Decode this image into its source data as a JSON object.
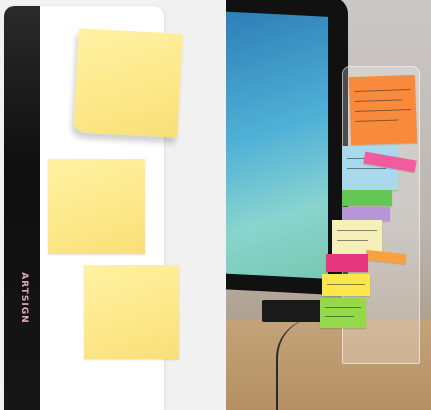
{
  "product_panel": {
    "brand_logo": "ARTSIGN",
    "colors": {
      "strip": "#111111",
      "board": "#ffffff",
      "sticky_note": "#fde98a",
      "logo": "#e2a9bd"
    },
    "sticky_notes": [
      "sticky-note-1",
      "sticky-note-2",
      "sticky-note-3"
    ]
  },
  "photo_panel": {
    "colors": {
      "screen": "#4fb0d6",
      "desk": "#b48f63",
      "wall": "#c4bfbb"
    },
    "memo_notes": [
      {
        "name": "orange-note",
        "color": "#f98a3b"
      },
      {
        "name": "light-blue-note",
        "color": "#a9d9ec"
      },
      {
        "name": "pink-tab",
        "color": "#f25c9c"
      },
      {
        "name": "green-note",
        "color": "#63c657"
      },
      {
        "name": "purple-note",
        "color": "#b695d8"
      },
      {
        "name": "light-yellow-note",
        "color": "#f5f0b8"
      },
      {
        "name": "orange-tab",
        "color": "#f7a23f"
      },
      {
        "name": "magenta-note",
        "color": "#e4377d"
      },
      {
        "name": "yellow-note",
        "color": "#fbe64b"
      },
      {
        "name": "bright-green-note",
        "color": "#93d94a"
      }
    ]
  }
}
